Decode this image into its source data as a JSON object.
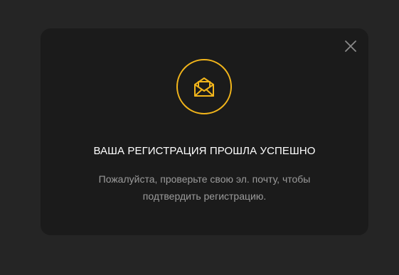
{
  "colors": {
    "backdrop": "#252525",
    "modal_background": "#1b1b1b",
    "accent": "#f2b51b",
    "title_text": "#ffffff",
    "body_text": "#9b9b9b",
    "close_icon": "#8a8a8a"
  },
  "modal": {
    "icon": "open-envelope-icon",
    "close_icon": "close-icon",
    "title": "ВАША РЕГИСТРАЦИЯ ПРОШЛА УСПЕШНО",
    "message_line1": "Пожалуйста, проверьте свою эл. почту, чтобы",
    "message_line2": "подтвердить регистрацию."
  }
}
